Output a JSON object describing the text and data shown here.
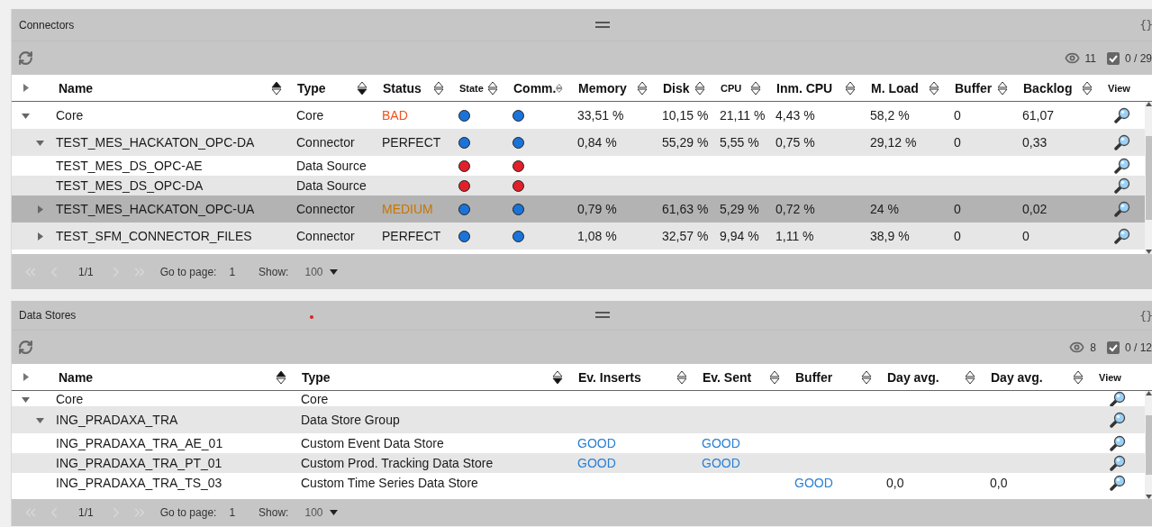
{
  "panels": [
    {
      "title": "Connectors",
      "braces": "{}",
      "visible_count": "11",
      "checked_count": "0 / 29",
      "notification": false,
      "columns": [
        {
          "label": "Name",
          "ascending": true,
          "descending": false
        },
        {
          "label": "Type",
          "ascending": false,
          "descending": true
        },
        {
          "label": "Status",
          "ascending": false,
          "descending": false
        },
        {
          "label": "State",
          "ascending": false,
          "descending": false
        },
        {
          "label": "Comm.",
          "ascending": false,
          "descending": false
        },
        {
          "label": "Memory",
          "ascending": false,
          "descending": false
        },
        {
          "label": "Disk",
          "ascending": false,
          "descending": false
        },
        {
          "label": "CPU",
          "ascending": false,
          "descending": false
        },
        {
          "label": "Inm. CPU",
          "ascending": false,
          "descending": false
        },
        {
          "label": "M. Load",
          "ascending": false,
          "descending": false
        },
        {
          "label": "Buffer",
          "ascending": false,
          "descending": false
        },
        {
          "label": "Backlog",
          "ascending": false,
          "descending": false
        },
        {
          "label": "View"
        }
      ],
      "rows": [
        {
          "expanded": true,
          "selected": false,
          "cells": [
            "Core",
            "Core",
            {
              "text": "BAD",
              "color": "#f4511e"
            },
            {
              "color": "#1a73d9"
            },
            {
              "color": "#1a73d9"
            },
            "33,51 %",
            "10,15 %",
            "21,11 %",
            "4,43 %",
            "58,2 %",
            "0",
            "61,07"
          ],
          "children": [
            {
              "expanded": true,
              "selected": false,
              "cells": [
                "TEST_MES_HACKATON_OPC-DA",
                "Connector",
                {
                  "text": "PERFECT",
                  "color": "#1a1a1a"
                },
                {
                  "color": "#1a73d9"
                },
                {
                  "color": "#1a73d9"
                },
                "0,84 %",
                "55,29 %",
                "5,55 %",
                "0,75 %",
                "29,12 %",
                "0",
                "0,33"
              ],
              "children": [
                {
                  "selected": false,
                  "cells": [
                    "TEST_MES_DS_OPC-AE",
                    "Data Source",
                    null,
                    {
                      "color": "#e0202a"
                    },
                    {
                      "color": "#e0202a"
                    },
                    null,
                    null,
                    null,
                    null,
                    null,
                    null,
                    null
                  ]
                },
                {
                  "selected": false,
                  "cells": [
                    "TEST_MES_DS_OPC-DA",
                    "Data Source",
                    null,
                    {
                      "color": "#e0202a"
                    },
                    {
                      "color": "#e0202a"
                    },
                    null,
                    null,
                    null,
                    null,
                    null,
                    null,
                    null
                  ]
                }
              ]
            },
            {
              "expanded": false,
              "selected": true,
              "cells": [
                "TEST_MES_HACKATON_OPC-UA",
                "Connector",
                {
                  "text": "MEDIUM",
                  "color": "#c97400"
                },
                {
                  "color": "#1a73d9"
                },
                {
                  "color": "#1a73d9"
                },
                "0,79 %",
                "61,63 %",
                "5,29 %",
                "0,72 %",
                "24 %",
                "0",
                "0,02"
              ]
            },
            {
              "expanded": false,
              "selected": false,
              "cells": [
                "TEST_SFM_CONNECTOR_FILES",
                "Connector",
                {
                  "text": "PERFECT",
                  "color": "#1a1a1a"
                },
                {
                  "color": "#1a73d9"
                },
                {
                  "color": "#1a73d9"
                },
                "1,08 %",
                "32,57 %",
                "9,94 %",
                "1,11 %",
                "38,9 %",
                "0",
                "0"
              ]
            }
          ]
        }
      ],
      "pager": {
        "page": "1/1",
        "goto_label": "Go to page:",
        "goto_value": "1",
        "show_label": "Show:",
        "show_value": "100"
      }
    },
    {
      "title": "Data Stores",
      "braces": "{}",
      "visible_count": "8",
      "checked_count": "0 / 12",
      "notification": true,
      "columns": [
        {
          "label": "Name",
          "ascending": true,
          "descending": false
        },
        {
          "label": "Type",
          "ascending": false,
          "descending": true
        },
        {
          "label": "Ev. Inserts",
          "ascending": false,
          "descending": false
        },
        {
          "label": "Ev. Sent",
          "ascending": false,
          "descending": false
        },
        {
          "label": "Buffer",
          "ascending": false,
          "descending": false
        },
        {
          "label": "Day avg.",
          "ascending": false,
          "descending": false
        },
        {
          "label": "Day avg.",
          "ascending": false,
          "descending": false
        },
        {
          "label": "View"
        }
      ],
      "rows": [
        {
          "expanded": true,
          "selected": false,
          "cells": [
            "Core",
            "Core",
            null,
            null,
            null,
            null,
            null
          ],
          "children": [
            {
              "expanded": true,
              "selected": false,
              "cells": [
                "ING_PRADAXA_TRA",
                "Data Store Group",
                null,
                null,
                null,
                null,
                null
              ],
              "children": [
                {
                  "selected": false,
                  "cells": [
                    "ING_PRADAXA_TRA_AE_01",
                    "Custom Event Data Store",
                    {
                      "text": "GOOD",
                      "color": "#2a7fd4"
                    },
                    {
                      "text": "GOOD",
                      "color": "#2a7fd4"
                    },
                    null,
                    null,
                    null
                  ]
                },
                {
                  "selected": false,
                  "cells": [
                    "ING_PRADAXA_TRA_PT_01",
                    "Custom Prod. Tracking Data Store",
                    {
                      "text": "GOOD",
                      "color": "#2a7fd4"
                    },
                    {
                      "text": "GOOD",
                      "color": "#2a7fd4"
                    },
                    null,
                    null,
                    null
                  ]
                },
                {
                  "selected": false,
                  "cells": [
                    "ING_PRADAXA_TRA_TS_03",
                    "Custom Time Series Data Store",
                    null,
                    null,
                    {
                      "text": "GOOD",
                      "color": "#2a7fd4"
                    },
                    "0,0",
                    "0,0"
                  ]
                }
              ]
            }
          ]
        }
      ],
      "pager": {
        "page": "1/1",
        "goto_label": "Go to page:",
        "goto_value": "1",
        "show_label": "Show:",
        "show_value": "100"
      }
    }
  ]
}
